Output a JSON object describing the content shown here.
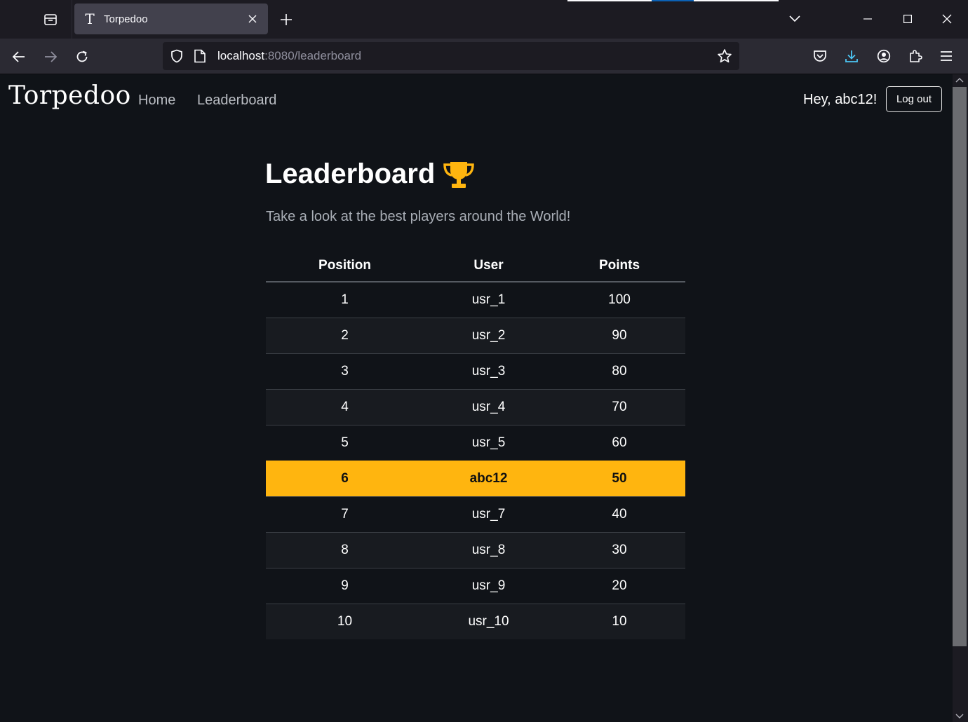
{
  "browser": {
    "tab_title": "Torpedoo",
    "tab_favicon": "T",
    "url_host": "localhost",
    "url_rest": ":8080/leaderboard",
    "accent": "#0df"
  },
  "site": {
    "brand": "Torpedoo",
    "nav": {
      "home": "Home",
      "leaderboard": "Leaderboard"
    },
    "greeting": "Hey, abc12!",
    "logout_label": "Log out"
  },
  "main": {
    "title": "Leaderboard",
    "title_icon": "trophy-icon",
    "subtitle": "Take a look at the best players around the World!",
    "highlight_color": "#ffb50f",
    "table": {
      "headers": {
        "position": "Position",
        "user": "User",
        "points": "Points"
      },
      "rows": [
        {
          "position": "1",
          "user": "usr_1",
          "points": "100",
          "current": false
        },
        {
          "position": "2",
          "user": "usr_2",
          "points": "90",
          "current": false
        },
        {
          "position": "3",
          "user": "usr_3",
          "points": "80",
          "current": false
        },
        {
          "position": "4",
          "user": "usr_4",
          "points": "70",
          "current": false
        },
        {
          "position": "5",
          "user": "usr_5",
          "points": "60",
          "current": false
        },
        {
          "position": "6",
          "user": "abc12",
          "points": "50",
          "current": true
        },
        {
          "position": "7",
          "user": "usr_7",
          "points": "40",
          "current": false
        },
        {
          "position": "8",
          "user": "usr_8",
          "points": "30",
          "current": false
        },
        {
          "position": "9",
          "user": "usr_9",
          "points": "20",
          "current": false
        },
        {
          "position": "10",
          "user": "usr_10",
          "points": "10",
          "current": false
        }
      ]
    }
  }
}
